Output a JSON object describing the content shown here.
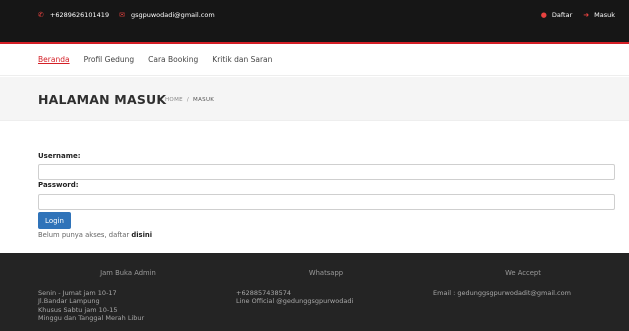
{
  "topbar": {
    "phone": "+6289626101419",
    "email": "gsgpuwodadi@gmail.com",
    "register_label": "Daftar",
    "login_label": "Masuk",
    "phone_icon": "phone-icon",
    "email_icon": "envelope-icon",
    "register_icon": "user-icon",
    "login_icon": "login-icon"
  },
  "nav": {
    "items": [
      {
        "label": "Beranda",
        "active": true
      },
      {
        "label": "Profil Gedung",
        "active": false
      },
      {
        "label": "Cara Booking",
        "active": false
      },
      {
        "label": "Kritik dan Saran",
        "active": false
      }
    ]
  },
  "page_header": {
    "title": "HALAMAN MASUK",
    "breadcrumb": [
      "HOME",
      "MASUK"
    ],
    "breadcrumb_sep": "/"
  },
  "form": {
    "username_label": "Username:",
    "username_value": "",
    "password_label": "Password:",
    "password_value": "",
    "login_button": "Login",
    "signup_text": "Belum punya akses, daftar ",
    "signup_link": "disini"
  },
  "footer": {
    "columns": [
      {
        "heading": "Jam Buka Admin",
        "lines": [
          "Senin - Jumat jam 10-17",
          "Jl.Bandar Lampung",
          "Khusus Sabtu jam 10-15",
          "Minggu dan Tanggal Merah Libur"
        ]
      },
      {
        "heading": "Whatsapp",
        "lines": [
          "+628857438574",
          "Line Official @gedunggsgpurwodadi"
        ]
      },
      {
        "heading": "We Accept",
        "lines": [
          "Email : gedunggsgpurwodadit@gmail.com"
        ]
      }
    ]
  },
  "colors": {
    "topbar_bg": "#161616",
    "accent_red": "#d41f26",
    "button_blue": "#2f73b9",
    "footer_bg": "#242424"
  }
}
